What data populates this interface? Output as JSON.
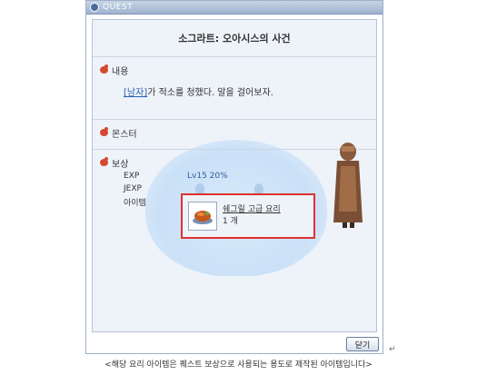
{
  "window": {
    "title": "QUEST",
    "quest_name": "소그라트: 오아시스의 사건",
    "close_label": "닫기"
  },
  "sections": {
    "content": {
      "header": "내용",
      "npc_link": "[남자]",
      "text": "가 적소를 청했다. 말을 걸어보자."
    },
    "monster": {
      "header": "몬스터"
    },
    "reward": {
      "header": "보상",
      "rows": [
        {
          "label": "EXP",
          "value": "Lv15 20%"
        },
        {
          "label": "JEXP",
          "value": ""
        },
        {
          "label": "아이템",
          "value": ""
        }
      ],
      "item": {
        "name": "쉐그릴 고급 요리",
        "count": "1 개",
        "icon": "roast-food-icon"
      }
    }
  },
  "caption": "<해당 요리 아이템은 퀘스트 보상으로 사용되는 용도로 제작된 아이템입니다>",
  "return_symbol": "↵",
  "colors": {
    "accent_red": "#e03030",
    "link_blue": "#2b5fb0",
    "panel_bg": "#eef3f9"
  }
}
